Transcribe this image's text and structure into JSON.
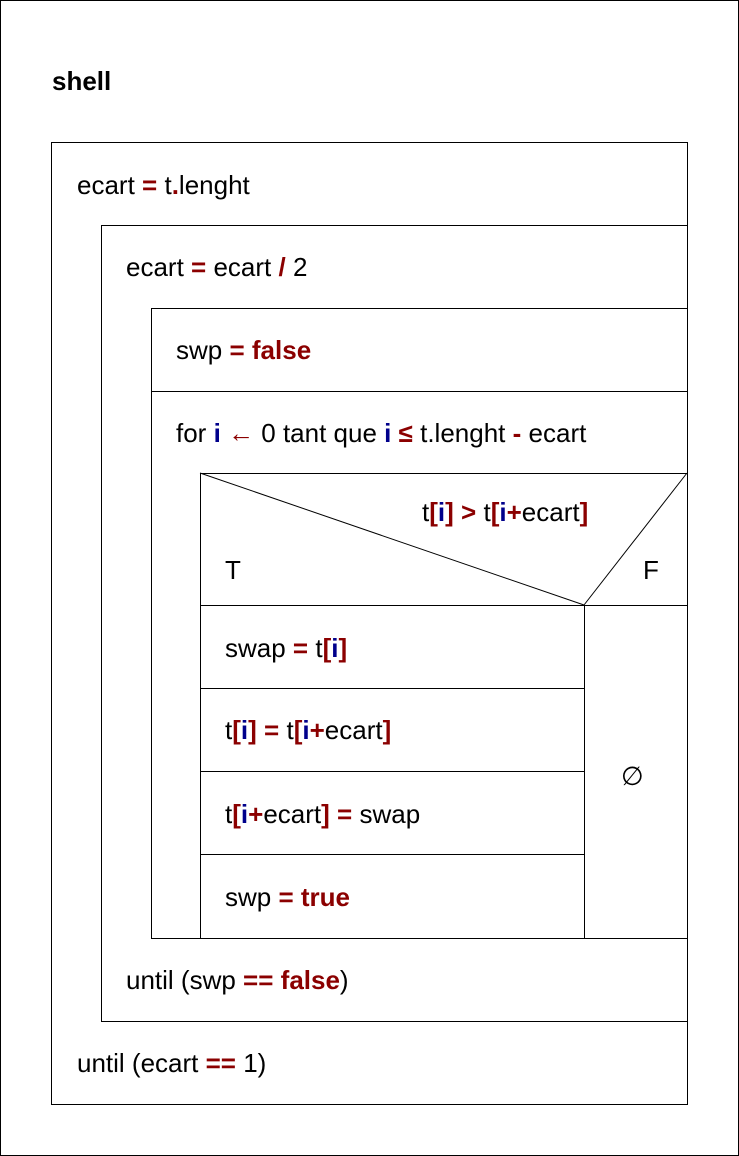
{
  "title": "shell",
  "blocks": {
    "init": [
      "ecart",
      " = ",
      "t",
      ".",
      "lenght"
    ],
    "halve": [
      "ecart",
      " = ",
      "ecart",
      " / ",
      "2"
    ],
    "reset_swp": [
      "swp",
      " = ",
      "false"
    ],
    "for_loop": [
      "for ",
      "i",
      " ← ",
      "0 tant que ",
      "i",
      " ≤ ",
      "t.lenght ",
      "-",
      " ecart"
    ],
    "condition": [
      "t",
      "[",
      "i",
      "]",
      " > ",
      "t",
      "[",
      "i",
      "+",
      "ecart",
      "]"
    ],
    "true_label": "T",
    "false_label": "F",
    "swap1": [
      "swap",
      " = ",
      "t",
      "[",
      "i",
      "]"
    ],
    "swap2": [
      "t",
      "[",
      "i",
      "]",
      " = ",
      "t",
      "[",
      "i",
      "+",
      "ecart",
      "]"
    ],
    "swap3": [
      "t",
      "[",
      "i",
      "+",
      "ecart",
      "]",
      " = ",
      "swap"
    ],
    "set_swp": [
      "swp",
      " = ",
      "true"
    ],
    "empty_branch": "∅",
    "until_swp": [
      "until (swp ",
      "==",
      " ",
      "false",
      ")"
    ],
    "until_ecart": [
      "until (ecart ",
      "==",
      " 1)"
    ]
  },
  "colors": {
    "operator": "#8b0000",
    "variable": "#00008b",
    "line": "#000000"
  }
}
